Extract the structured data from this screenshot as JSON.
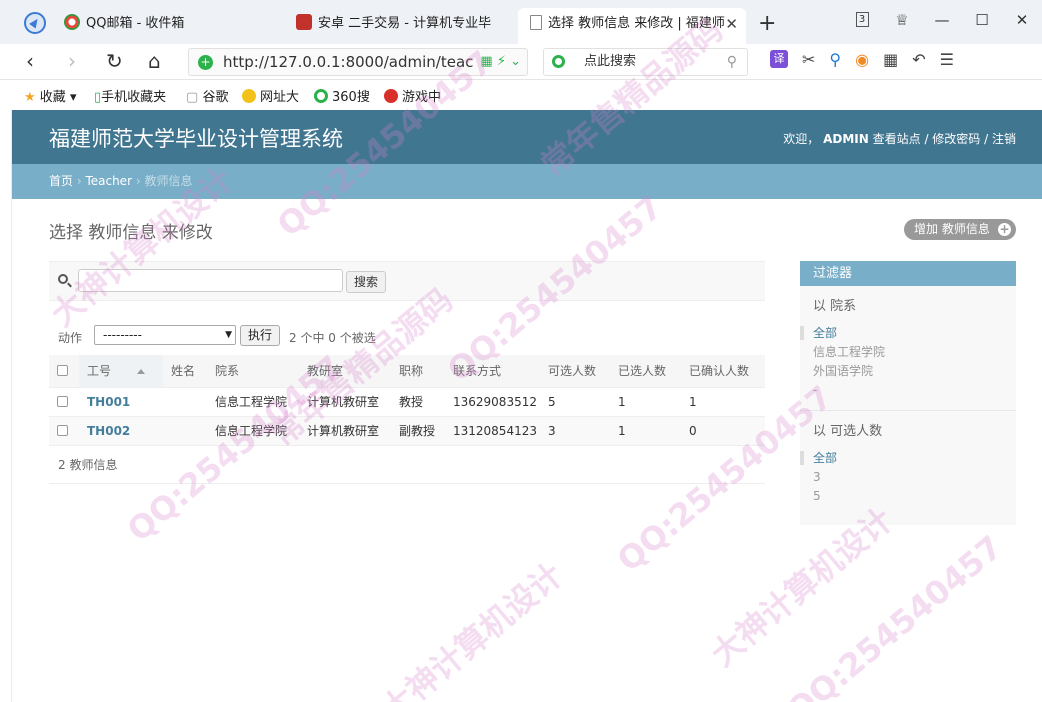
{
  "browser": {
    "tabs": [
      {
        "title": "QQ邮箱 - 收件箱"
      },
      {
        "title": "安卓 二手交易 - 计算机专业毕"
      },
      {
        "title": "选择 教师信息 来修改 | 福建师",
        "active": true
      }
    ],
    "tab_count": "3",
    "address": {
      "url_main": "http://127.0.0.1:8000/admin/teac",
      "url_dim": ""
    },
    "search_placeholder": "点此搜索",
    "translate_label": "译",
    "bookmarks": [
      {
        "label": "收藏"
      },
      {
        "label": "手机收藏夹"
      },
      {
        "label": "谷歌"
      },
      {
        "label": "网址大"
      },
      {
        "label": "360搜"
      },
      {
        "label": "游戏中"
      }
    ]
  },
  "admin": {
    "site_title": "福建师范大学毕业设计管理系统",
    "user_tools": {
      "welcome": "欢迎，",
      "username": "ADMIN",
      "view_site": "查看站点",
      "change_password": "修改密码",
      "logout": "注销",
      "sep": " / "
    },
    "breadcrumbs": {
      "home": "首页",
      "app": "Teacher",
      "current": "教师信息",
      "sep": " › "
    },
    "title": "选择 教师信息 来修改",
    "add_button": "增加 教师信息",
    "search_button": "搜索",
    "action_label": "动作",
    "action_select": "---------",
    "go_button": "执行",
    "selection_counter": "2 个中 0 个被选",
    "columns": [
      "工号",
      "姓名",
      "院系",
      "教研室",
      "职称",
      "联系方式",
      "可选人数",
      "已选人数",
      "已确认人数"
    ],
    "rows": [
      {
        "id": "TH001",
        "name": "",
        "dept": "信息工程学院",
        "office": "计算机教研室",
        "title": "教授",
        "phone": "13629083512",
        "capacity": "5",
        "selected": "1",
        "confirmed": "1"
      },
      {
        "id": "TH002",
        "name": "",
        "dept": "信息工程学院",
        "office": "计算机教研室",
        "title": "副教授",
        "phone": "13120854123",
        "capacity": "3",
        "selected": "1",
        "confirmed": "0"
      }
    ],
    "result_count": "2 教师信息",
    "filter": {
      "heading": "过滤器",
      "groups": [
        {
          "title": "以 院系",
          "options": [
            "全部",
            "信息工程学院",
            "外国语学院",
            "-"
          ]
        },
        {
          "title": "以 可选人数",
          "options": [
            "全部",
            "3",
            "5"
          ]
        }
      ]
    }
  },
  "watermark": {
    "qq": "QQ:254540457",
    "text1": "常年售精品源码",
    "text2": "大神计算机设计"
  },
  "colors": {
    "header": "#417690",
    "breadcrumbs": "#79aec8",
    "link": "#447e9b"
  }
}
